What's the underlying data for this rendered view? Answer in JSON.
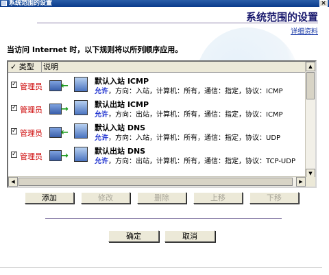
{
  "window": {
    "title": "系统范围的设置",
    "close_label": "×"
  },
  "header": {
    "title": "系统范围的设置",
    "details_link": "详细资料"
  },
  "instruction": "当访问 Internet 时，以下规则将以所列顺序应用。",
  "list": {
    "columns": {
      "type": "类型",
      "description": "说明"
    },
    "rows": [
      {
        "checked": true,
        "owner": "管理员",
        "name": "默认入站 ICMP",
        "action": "允许",
        "details": "，方向：入站，计算机：所有，通信：指定，协议：ICMP",
        "arrow": "←"
      },
      {
        "checked": true,
        "owner": "管理员",
        "name": "默认出站 ICMP",
        "action": "允许",
        "details": "，方向：出站，计算机：所有，通信：指定，协议：ICMP",
        "arrow": "→"
      },
      {
        "checked": true,
        "owner": "管理员",
        "name": "默认入站 DNS",
        "action": "允许",
        "details": "，方向：入站，计算机：所有，通信：指定，协议：UDP",
        "arrow": "←"
      },
      {
        "checked": true,
        "owner": "管理员",
        "name": "默认出站 DNS",
        "action": "允许",
        "details": "，方向：出站，计算机：所有，通信：指定，协议：TCP-UDP",
        "arrow": "→"
      }
    ]
  },
  "buttons": {
    "add": "添加",
    "edit": "修改",
    "remove": "删除",
    "move_up": "上移",
    "move_down": "下移",
    "ok": "确定",
    "cancel": "取消"
  },
  "colors": {
    "owner": "#cc0000",
    "allow": "#1a2ed0",
    "title": "#1a1a6e"
  }
}
